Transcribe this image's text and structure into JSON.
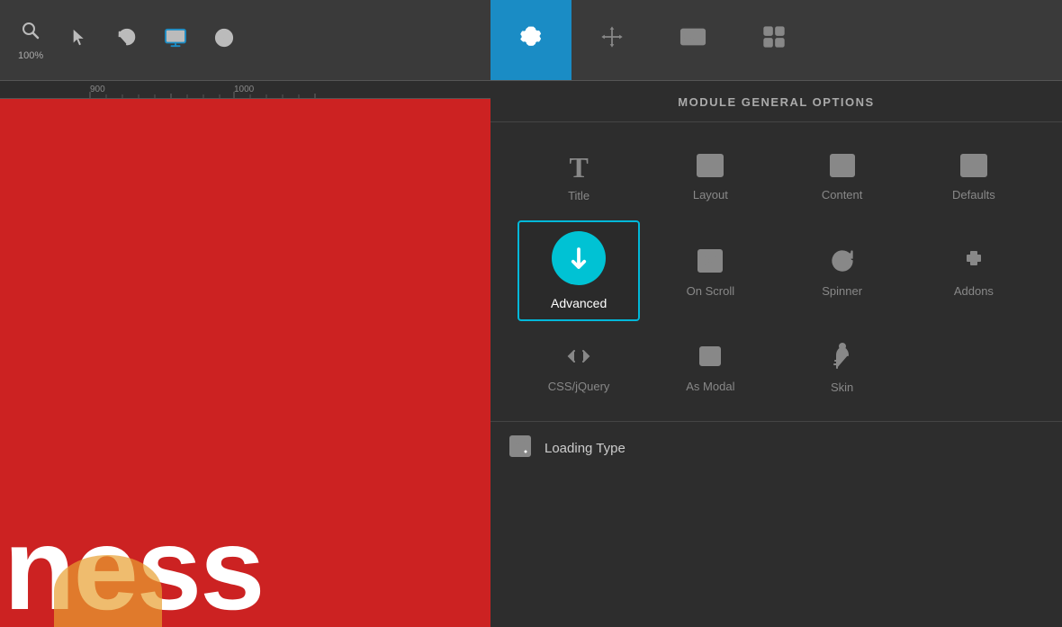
{
  "toolbar": {
    "zoom_label": "100%",
    "tabs": [
      {
        "id": "settings",
        "label": "settings",
        "icon": "⚙",
        "active": true
      },
      {
        "id": "move",
        "label": "move",
        "icon": "✛",
        "active": false
      },
      {
        "id": "media",
        "label": "media",
        "icon": "▦",
        "active": false
      },
      {
        "id": "layers",
        "label": "layers",
        "icon": "◫",
        "active": false
      }
    ]
  },
  "ruler": {
    "marks": [
      "900",
      "1000"
    ]
  },
  "canvas": {
    "text": "iness"
  },
  "panel": {
    "header": "MODULE GENERAL OPTIONS",
    "grid": [
      {
        "id": "title",
        "label": "Title",
        "icon": "T",
        "type": "text"
      },
      {
        "id": "layout",
        "label": "Layout",
        "icon": "layout",
        "type": "svg"
      },
      {
        "id": "content",
        "label": "Content",
        "icon": "content",
        "type": "svg"
      },
      {
        "id": "defaults",
        "label": "Defaults",
        "icon": "defaults",
        "type": "svg"
      },
      {
        "id": "advanced",
        "label": "Advanced",
        "icon": "↓",
        "type": "cyan",
        "selected": true
      },
      {
        "id": "onscroll",
        "label": "On Scroll",
        "icon": "onscroll",
        "type": "svg"
      },
      {
        "id": "spinner",
        "label": "Spinner",
        "icon": "spinner",
        "type": "svg"
      },
      {
        "id": "addons",
        "label": "Addons",
        "icon": "addons",
        "type": "svg"
      },
      {
        "id": "cssjquery",
        "label": "CSS/jQuery",
        "icon": "cssjquery",
        "type": "svg"
      },
      {
        "id": "asmodal",
        "label": "As Modal",
        "icon": "asmodal",
        "type": "svg"
      },
      {
        "id": "skin",
        "label": "Skin",
        "icon": "skin",
        "type": "svg"
      }
    ],
    "bottom": {
      "label": "Loading Type",
      "icon": "loading"
    }
  }
}
